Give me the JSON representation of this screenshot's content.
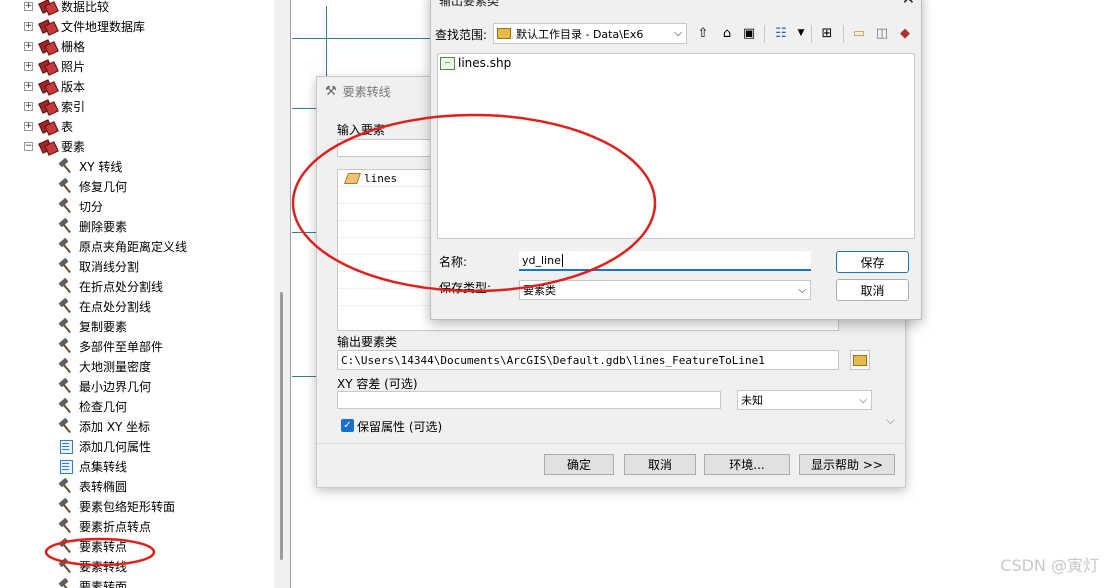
{
  "tree": {
    "items": [
      {
        "label": "数据比较",
        "kind": "toolbox",
        "expander": "+"
      },
      {
        "label": "文件地理数据库",
        "kind": "toolbox",
        "expander": "+"
      },
      {
        "label": "栅格",
        "kind": "toolbox",
        "expander": "+"
      },
      {
        "label": "照片",
        "kind": "toolbox",
        "expander": "+"
      },
      {
        "label": "版本",
        "kind": "toolbox",
        "expander": "+"
      },
      {
        "label": "索引",
        "kind": "toolbox",
        "expander": "+"
      },
      {
        "label": "表",
        "kind": "toolbox",
        "expander": "+"
      },
      {
        "label": "要素",
        "kind": "toolbox",
        "expander": "−"
      }
    ],
    "tools": [
      {
        "label": "XY 转线",
        "icon": "hammer-icon"
      },
      {
        "label": "修复几何",
        "icon": "hammer-icon"
      },
      {
        "label": "切分",
        "icon": "hammer-icon"
      },
      {
        "label": "删除要素",
        "icon": "hammer-icon"
      },
      {
        "label": "原点夹角距离定义线",
        "icon": "hammer-icon"
      },
      {
        "label": "取消线分割",
        "icon": "hammer-icon"
      },
      {
        "label": "在折点处分割线",
        "icon": "hammer-icon"
      },
      {
        "label": "在点处分割线",
        "icon": "hammer-icon"
      },
      {
        "label": "复制要素",
        "icon": "hammer-icon"
      },
      {
        "label": "多部件至单部件",
        "icon": "hammer-icon"
      },
      {
        "label": "大地测量密度",
        "icon": "hammer-icon"
      },
      {
        "label": "最小边界几何",
        "icon": "hammer-icon"
      },
      {
        "label": "检查几何",
        "icon": "hammer-icon"
      },
      {
        "label": "添加 XY 坐标",
        "icon": "hammer-icon"
      },
      {
        "label": "添加几何属性",
        "icon": "script-icon"
      },
      {
        "label": "点集转线",
        "icon": "script-icon"
      },
      {
        "label": "表转椭圆",
        "icon": "hammer-icon"
      },
      {
        "label": "要素包络矩形转面",
        "icon": "hammer-icon"
      },
      {
        "label": "要素折点转点",
        "icon": "hammer-icon"
      },
      {
        "label": "要素转点",
        "icon": "hammer-icon"
      },
      {
        "label": "要素转线",
        "icon": "hammer-icon"
      },
      {
        "label": "要素转面",
        "icon": "hammer-icon"
      }
    ]
  },
  "tool_dialog": {
    "title": "要素转线",
    "input_label": "输入要素",
    "input_list": [
      "lines"
    ],
    "output_label": "输出要素类",
    "output_value": "C:\\Users\\14344\\Documents\\ArcGIS\\Default.gdb\\lines_FeatureToLine1",
    "xy_label": "XY 容差 (可选)",
    "xy_value": "",
    "unit_value": "未知",
    "keep_label": "保留属性 (可选)",
    "keep_checked": true,
    "buttons": {
      "ok": "确定",
      "cancel": "取消",
      "env": "环境...",
      "help": "显示帮助 >>"
    }
  },
  "save_dialog": {
    "title": "输出要素类",
    "lookin_label": "查找范围:",
    "lookin_value": "默认工作目录 - Data\\Ex6",
    "files": [
      "lines.shp"
    ],
    "name_label": "名称:",
    "name_value": "yd_line",
    "type_label": "保存类型:",
    "type_value": "要素类",
    "save_button": "保存",
    "cancel_button": "取消"
  },
  "colors": {
    "annotation": "#e0201b",
    "accent": "#1a73c8",
    "map_line": "#2f7f9a"
  },
  "watermark": "CSDN @寅灯"
}
